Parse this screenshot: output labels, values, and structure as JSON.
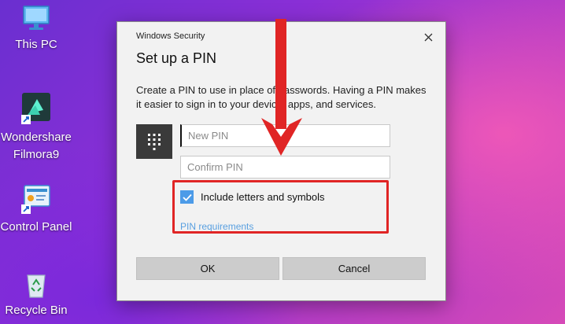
{
  "desktop": {
    "icons": [
      {
        "label": "This PC",
        "icon": "this-pc-icon"
      },
      {
        "label": "Wondershare Filmora9",
        "icon": "filmora-icon"
      },
      {
        "label": "Control Panel",
        "icon": "control-panel-icon"
      },
      {
        "label": "Recycle Bin",
        "icon": "recycle-bin-icon"
      }
    ]
  },
  "dialog": {
    "window_title": "Windows Security",
    "heading": "Set up a PIN",
    "description": "Create a PIN to use in place of passwords. Having a PIN makes it easier to sign in to your device, apps, and services.",
    "new_pin_placeholder": "New PIN",
    "confirm_pin_placeholder": "Confirm PIN",
    "include_letters_label": "Include letters and symbols",
    "include_letters_checked": true,
    "pin_requirements_link": "PIN requirements",
    "ok_label": "OK",
    "cancel_label": "Cancel"
  },
  "annotation": {
    "highlight_color": "#e02525",
    "arrow_color": "#e02525"
  },
  "colors": {
    "checkbox_accent": "#4c9be8",
    "link": "#5aa0e0",
    "keypad_tile": "#3a3a3a"
  }
}
